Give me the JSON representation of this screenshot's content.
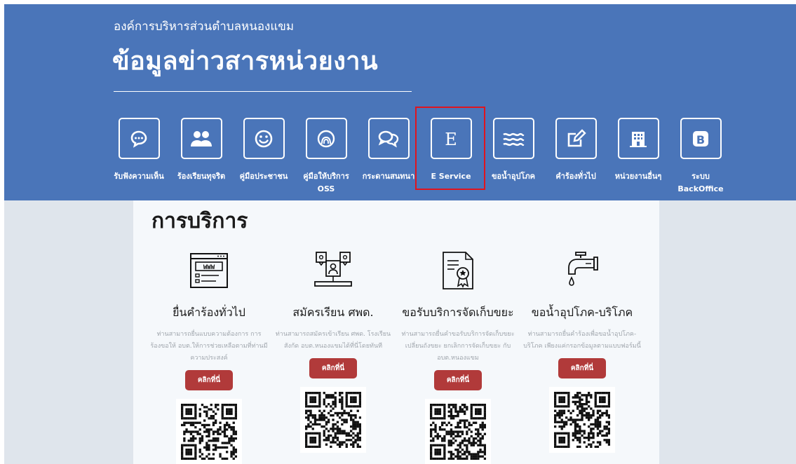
{
  "header": {
    "org_name": "องค์การบริหารส่วนตำบลหนองแขม",
    "title": "ข้อมูลข่าวสารหน่วยงาน",
    "nav": [
      {
        "label": "รับฟังความเห็น",
        "icon": "chat-bubble-icon"
      },
      {
        "label": "ร้องเรียนทุจริต",
        "icon": "users-icon"
      },
      {
        "label": "คู่มือประชาชน",
        "icon": "smiley-icon"
      },
      {
        "label": "คู่มือให้บริการ OSS",
        "icon": "fingerprint-icon"
      },
      {
        "label": "กระดานสนทนา",
        "icon": "discussion-icon"
      },
      {
        "label": "E Service",
        "icon": "e-letter-icon",
        "highlighted": true
      },
      {
        "label": "ขอน้ำอุปโภค",
        "icon": "water-waves-icon"
      },
      {
        "label": "คำร้องทั่วไป",
        "icon": "edit-icon"
      },
      {
        "label": "หน่วยงานอื่นๆ",
        "icon": "building-icon"
      },
      {
        "label": "ระบบ BackOffice",
        "icon": "b-letter-icon"
      }
    ]
  },
  "services": {
    "title": "การบริการ",
    "cards": [
      {
        "title": "ยื่นคำร้องทั่วไป",
        "desc": "ท่านสามารถยื่นแบบความต้องการ การร้องขอให้ อบต.ให้การช่วยเหลือตามที่ท่านมีความประสงค์",
        "button": "คลิกที่นี่",
        "icon": "website-icon"
      },
      {
        "title": "สมัครเรียน ศพด.",
        "desc": "ท่านสามารถสมัครเข้าเรียน ศพด. โรงเรียนสังกัด อบต.หนองแขมได้ที่นี่โดยทันที",
        "button": "คลิกที่นี่",
        "icon": "student-board-icon"
      },
      {
        "title": "ขอรับบริการจัดเก็บขยะ",
        "desc": "ท่านสามารถยื่นคำขอรับบริการจัดเก็บขยะ เปลี่ยนถังขยะ ยกเลิกการจัดเก็บขยะ กับ อบต.หนองแขม",
        "button": "คลิกที่นี่",
        "icon": "certificate-icon"
      },
      {
        "title": "ขอน้ำอุปโภค-บริโภค",
        "desc": "ท่านสามารถยื่นคำร้องเพื่อขอน้ำอุปโภค-บริโภค เพียงแค่กรอกข้อมูลตามแบบฟอร์มนี้",
        "button": "คลิกที่นี่",
        "icon": "water-tap-icon"
      }
    ]
  },
  "colors": {
    "header_bg": "#4a75b9",
    "page_bg": "#dfe5ec",
    "content_bg": "#f5f8fb",
    "button_bg": "#b13a3a",
    "highlight_border": "#e0141e"
  }
}
